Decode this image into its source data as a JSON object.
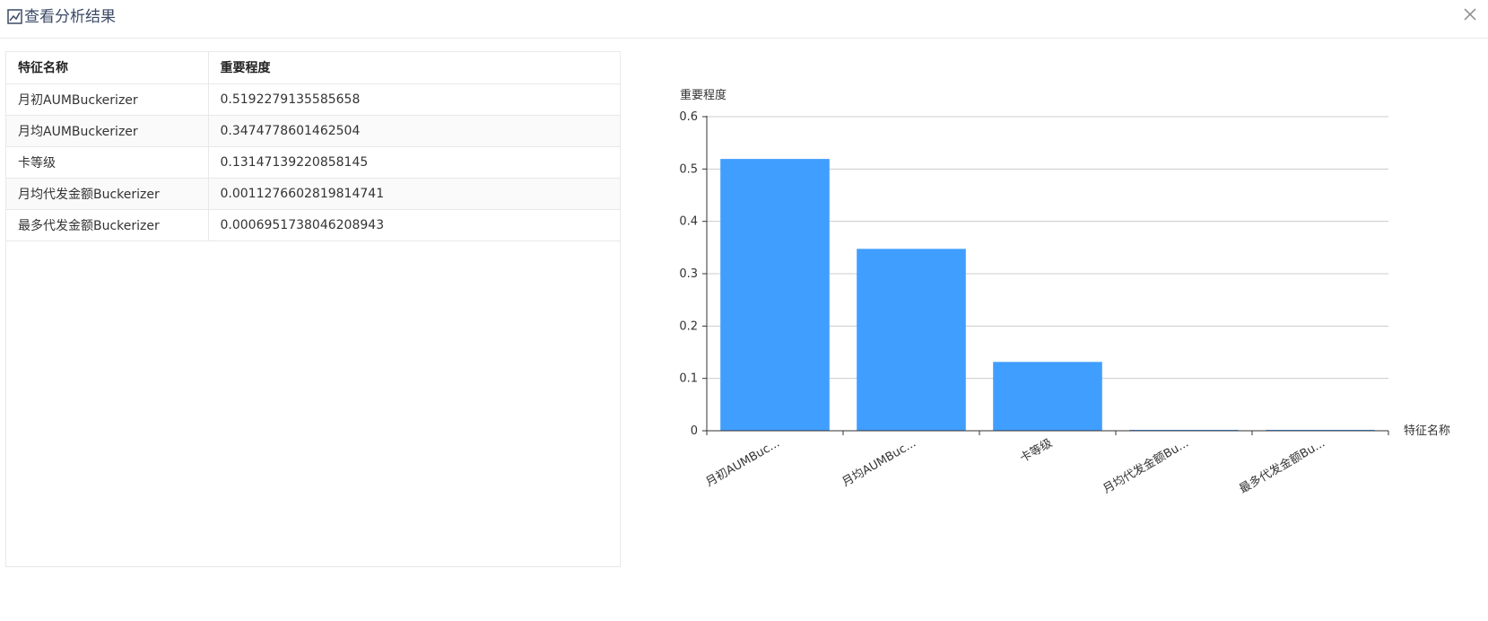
{
  "dialog": {
    "title": "查看分析结果",
    "icon": "chart-icon",
    "close_icon": "close-icon"
  },
  "table": {
    "headers": [
      "特征名称",
      "重要程度"
    ],
    "rows": [
      [
        "月初AUMBuckerizer",
        "0.5192279135585658"
      ],
      [
        "月均AUMBuckerizer",
        "0.3474778601462504"
      ],
      [
        "卡等级",
        "0.13147139220858145"
      ],
      [
        "月均代发金额Buckerizer",
        "0.0011276602819814741"
      ],
      [
        "最多代发金额Buckerizer",
        "0.0006951738046208943"
      ]
    ]
  },
  "chart_data": {
    "type": "bar",
    "ylabel": "重要程度",
    "xlabel": "特征名称",
    "categories": [
      "月初AUMBuc...",
      "月均AUMBuc...",
      "卡等级",
      "月均代发金额Bu...",
      "最多代发金额Bu..."
    ],
    "values": [
      0.5192279135585658,
      0.3474778601462504,
      0.13147139220858145,
      0.0011276602819814741,
      0.0006951738046208943
    ],
    "ylim": [
      0,
      0.6
    ],
    "yticks": [
      "0",
      "0.1",
      "0.2",
      "0.3",
      "0.4",
      "0.5",
      "0.6"
    ],
    "grid": true,
    "bar_color": "#409eff",
    "axis_color": "#333333",
    "grid_color": "#cccccc"
  }
}
